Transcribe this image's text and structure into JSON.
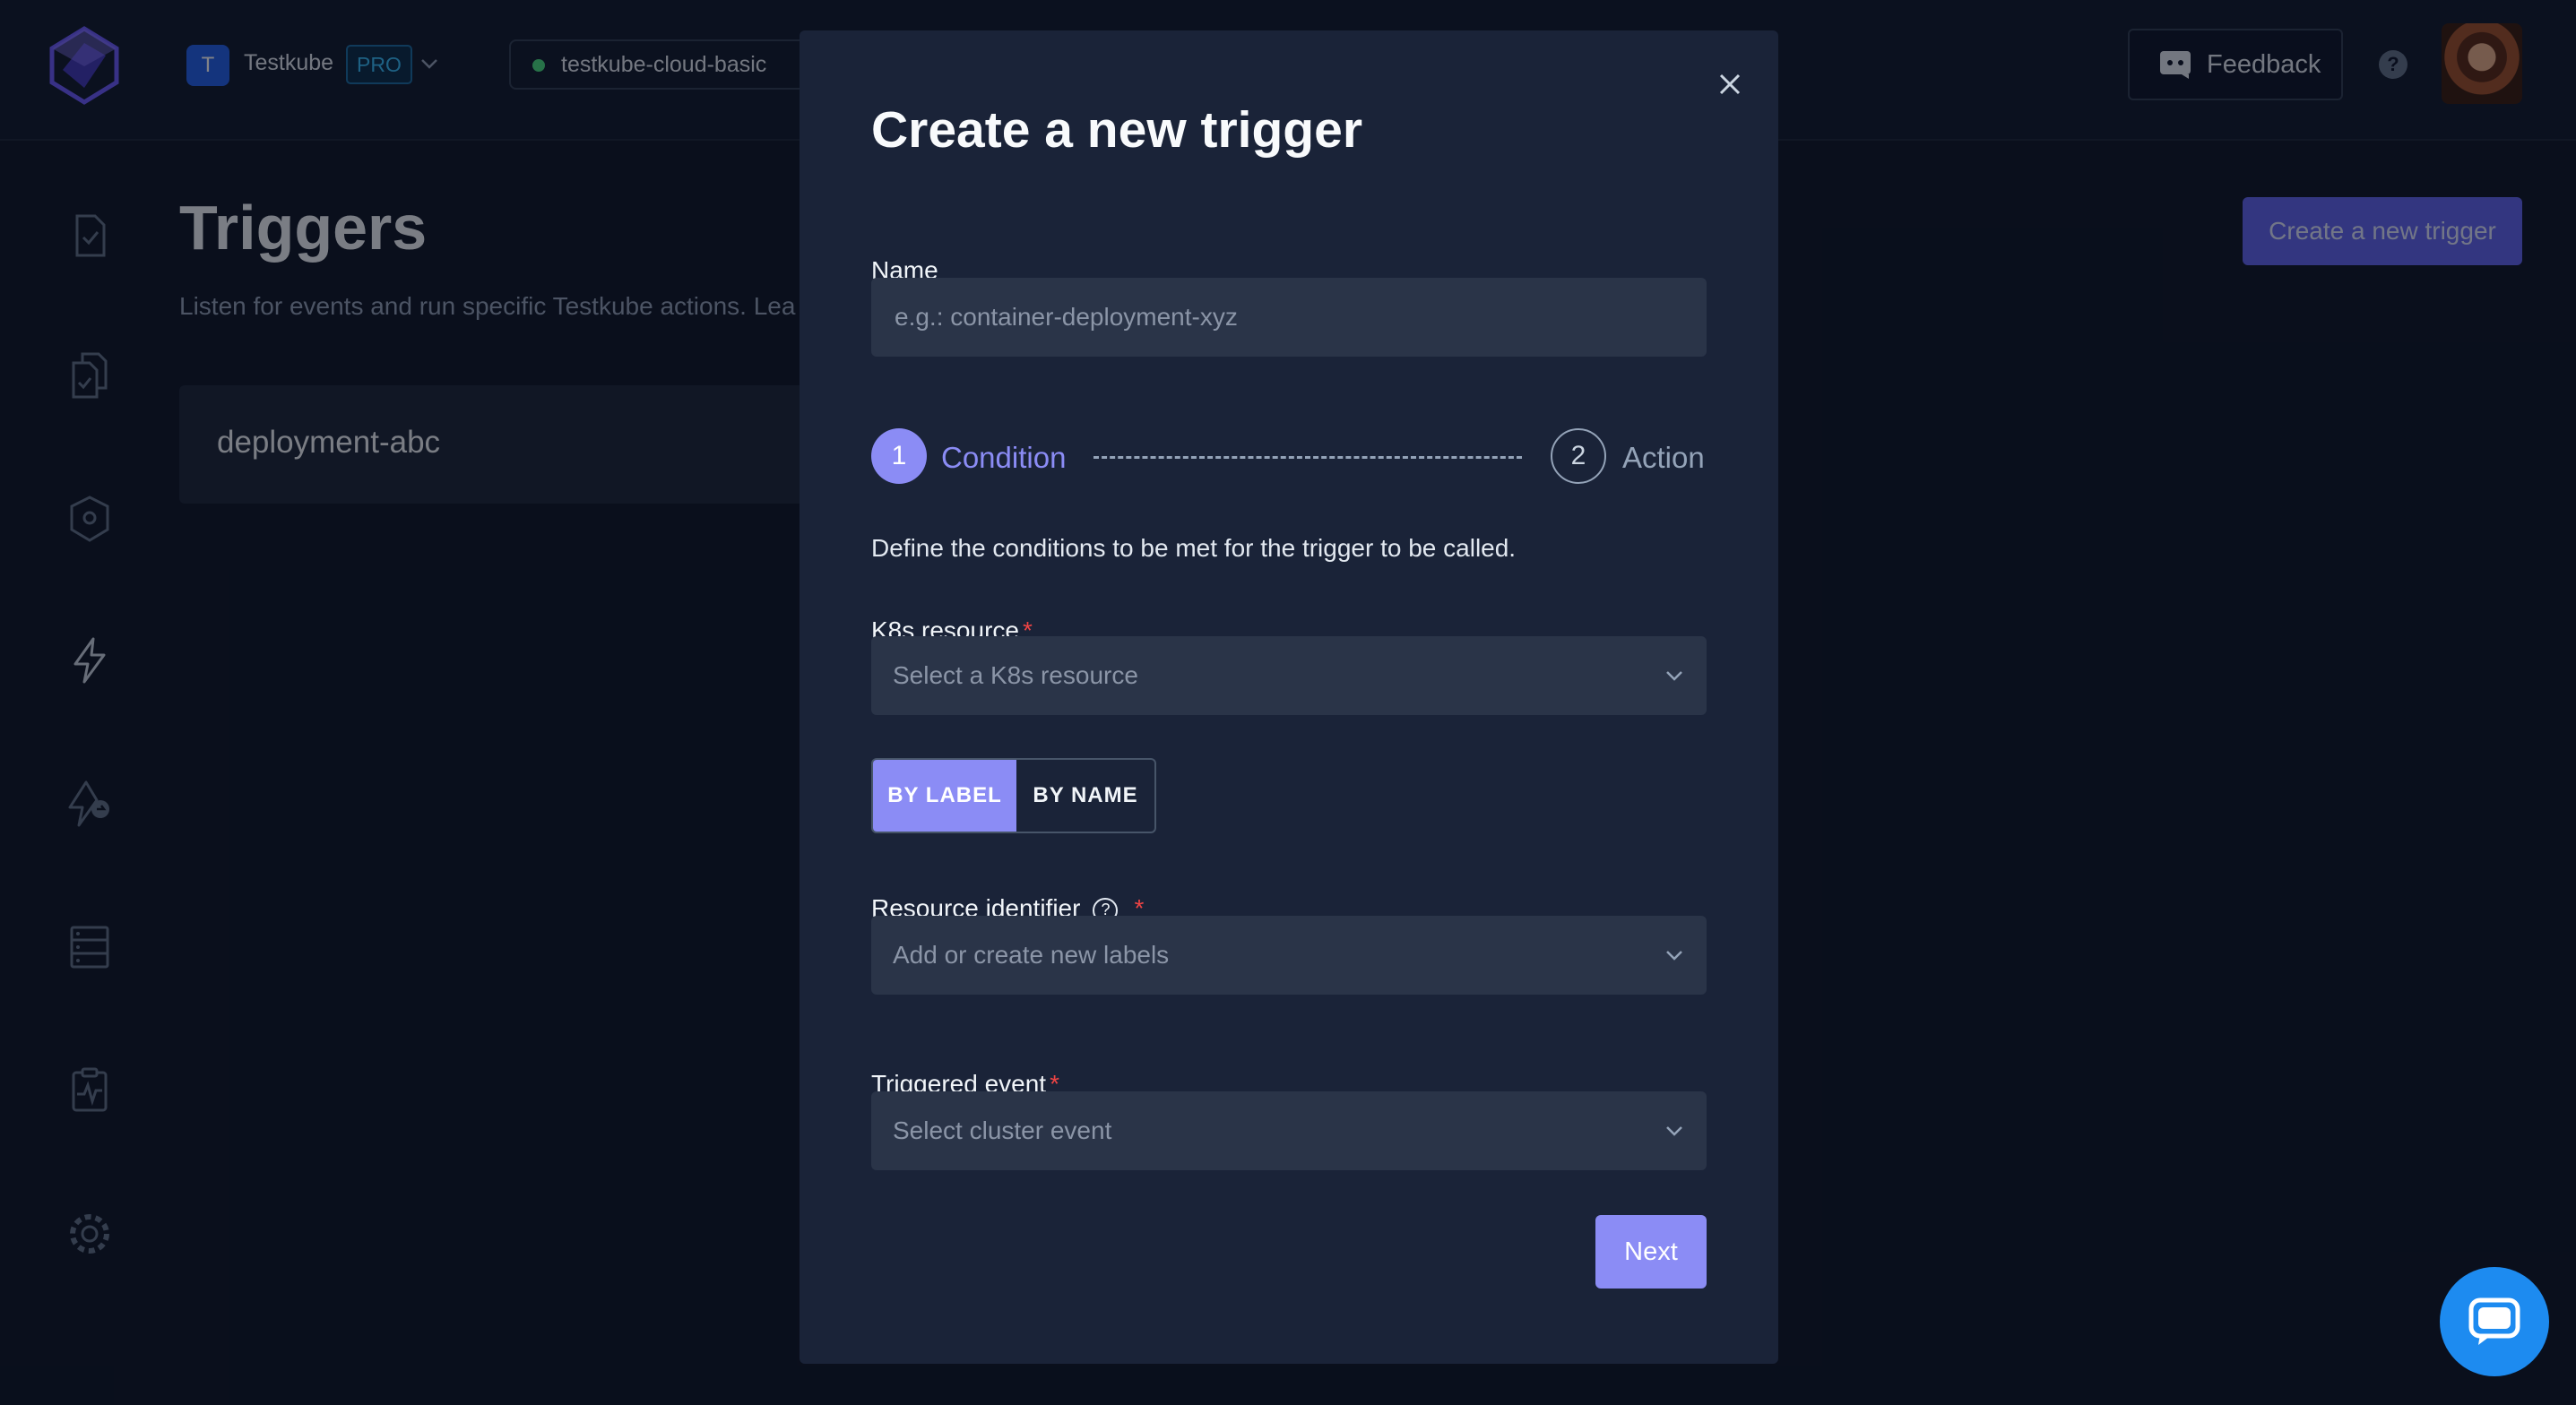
{
  "topbar": {
    "org_initial": "T",
    "org_name": "Testkube",
    "plan_badge": "PRO",
    "environment": "testkube-cloud-basic",
    "feedback_label": "Feedback",
    "help_icon": "question-circle-icon"
  },
  "sidebar": {
    "icons": [
      "tests-icon",
      "test-suites-icon",
      "executors-icon",
      "triggers-icon",
      "webhooks-icon",
      "sources-icon",
      "status-icon",
      "settings-icon"
    ]
  },
  "page": {
    "title": "Triggers",
    "description": "Listen for events and run specific Testkube actions. Lea",
    "create_button": "Create a new trigger",
    "triggers": [
      {
        "name": "deployment-abc"
      }
    ]
  },
  "modal": {
    "title": "Create a new trigger",
    "name_label": "Name",
    "name_placeholder": "e.g.: container-deployment-xyz",
    "name_value": "",
    "steps": [
      {
        "number": "1",
        "label": "Condition",
        "active": true
      },
      {
        "number": "2",
        "label": "Action",
        "active": false
      }
    ],
    "step_description": "Define the conditions to be met for the trigger to be called.",
    "k8s_resource_label": "K8s resource",
    "k8s_resource_placeholder": "Select a K8s resource",
    "identifier_toggle": {
      "active": "BY LABEL",
      "inactive": "BY NAME"
    },
    "resource_identifier_label": "Resource identifier",
    "resource_identifier_placeholder": "Add or create new labels",
    "triggered_event_label": "Triggered event",
    "triggered_event_placeholder": "Select cluster event",
    "required_marker": "*",
    "next_button": "Next"
  },
  "colors": {
    "accent": "#8b8cf5",
    "primary_button": "#6366f1",
    "required": "#ef4444",
    "env_status": "#4ade80",
    "chat": "#1d8bf0"
  }
}
